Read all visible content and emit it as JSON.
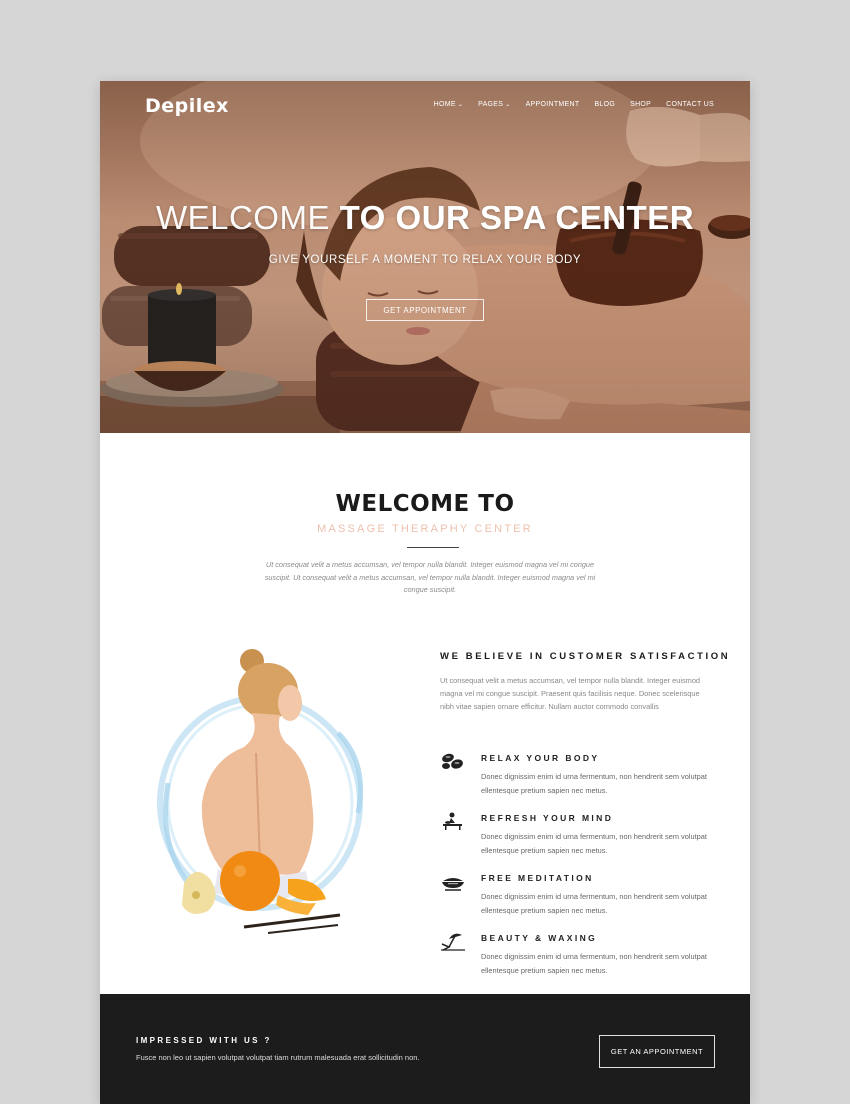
{
  "brand": {
    "logo": "Depilex"
  },
  "nav": {
    "items": [
      {
        "label": "HOME",
        "dropdown": true
      },
      {
        "label": "PAGES",
        "dropdown": true
      },
      {
        "label": "APPOINTMENT",
        "dropdown": false
      },
      {
        "label": "BLOG",
        "dropdown": false
      },
      {
        "label": "SHOP",
        "dropdown": false
      },
      {
        "label": "CONTACT US",
        "dropdown": false
      }
    ]
  },
  "hero": {
    "title_light": "WELCOME ",
    "title_bold": "TO OUR SPA CENTER",
    "subtitle": "GIVE YOURSELF A MOMENT TO RELAX YOUR BODY",
    "button": "GET APPOINTMENT"
  },
  "welcome": {
    "title": "WELCOME TO",
    "subtitle": "MASSAGE THERAPHY CENTER",
    "text": "Ut consequat velit a metus accumsan, vel tempor nulla blandit. Integer euismod magna vel mi congue suscipit. Ut consequat velit a metus accumsan, vel tempor nulla blandit. Integer euismod magna vel mi congue suscipit."
  },
  "feature": {
    "heading": "WE BELIEVE IN CUSTOMER SATISFACTION",
    "text": "Ut consequat velit a metus accumsan, vel tempor nulla blandit. Integer euismod magna vel mi congue suscipit. Praesent quis facilisis neque. Donec scelerisque nibh vitae sapien ornare efficitur. Nullam auctor commodo convallis",
    "items": [
      {
        "icon": "stones-icon",
        "title": "RELAX YOUR BODY",
        "desc": "Donec dignissim enim id urna fermentum, non hendrerit sem volutpat ellentesque pretium sapien nec metus."
      },
      {
        "icon": "massage-icon",
        "title": "REFRESH YOUR MIND",
        "desc": "Donec dignissim enim id urna fermentum, non hendrerit sem volutpat ellentesque pretium sapien nec metus."
      },
      {
        "icon": "meditation-bowl-icon",
        "title": "FREE MEDITATION",
        "desc": "Donec dignissim enim id urna fermentum, non hendrerit sem volutpat ellentesque pretium sapien nec metus."
      },
      {
        "icon": "beach-umbrella-icon",
        "title": "BEAUTY & WAXING",
        "desc": "Donec dignissim enim id urna fermentum, non hendrerit sem volutpat ellentesque pretium sapien nec metus."
      }
    ]
  },
  "cta": {
    "heading": "IMPRESSED WITH US ?",
    "text": "Fusce non leo ut sapien volutpat volutpat tiam rutrum malesuada erat sollicitudin non.",
    "button": "GET AN APPOINTMENT"
  },
  "colors": {
    "accent": "#eec0ae",
    "dark": "#1c1c1c",
    "hero_tone": "#c69478"
  }
}
